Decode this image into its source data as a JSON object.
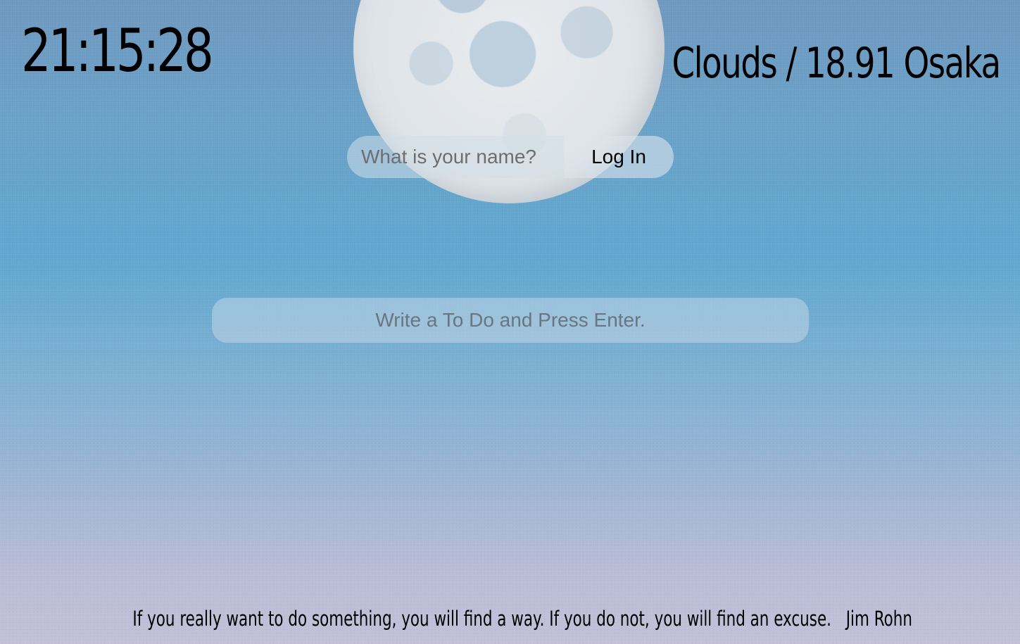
{
  "clock": {
    "time": "21:15:28"
  },
  "weather": {
    "text": "Clouds / 18.91 Osaka"
  },
  "login": {
    "name_placeholder": "What is your name?",
    "name_value": "",
    "button_label": "Log In"
  },
  "todo": {
    "placeholder": "Write a To Do and Press Enter.",
    "value": ""
  },
  "quote": {
    "text": "If you really want to do something, you will find a way. If you do not, you will find an excuse.",
    "author": "Jim Rohn"
  },
  "background": {
    "image": "moon-in-sky",
    "colors": [
      "#6f98bf",
      "#5fa7cf",
      "#9db5d4",
      "#c3c0d8"
    ]
  }
}
